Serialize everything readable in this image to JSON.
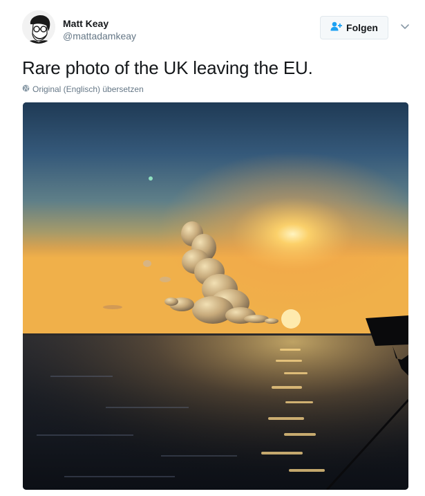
{
  "author": {
    "display_name": "Matt Keay",
    "handle": "@mattadamkeay"
  },
  "follow_button": {
    "label": "Folgen",
    "icon": "add-user-icon",
    "accent": "#1da1f2"
  },
  "menu": {
    "icon": "chevron-down-icon"
  },
  "tweet": {
    "text": "Rare photo of the UK leaving the EU.",
    "translate_label": "Original (Englisch) übersetzen",
    "translate_icon": "globe-icon"
  },
  "media": {
    "type": "photo",
    "description_icon": "sunset-photo"
  },
  "colors": {
    "text": "#14171a",
    "secondary": "#657786",
    "button_bg": "#f5f8fa",
    "border": "#e1e8ed"
  }
}
